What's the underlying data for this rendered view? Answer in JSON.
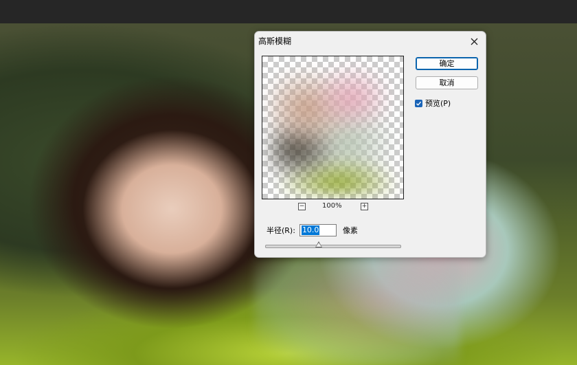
{
  "dialog": {
    "title": "高斯模糊",
    "ok_label": "确定",
    "cancel_label": "取消",
    "preview_label": "预览(P)",
    "preview_checked": true,
    "zoom_level": "100%",
    "zoom_out_symbol": "−",
    "zoom_in_symbol": "+",
    "radius_label": "半径(R):",
    "radius_value": "10.0",
    "radius_unit": "像素",
    "radius_slider_fraction": 0.4
  },
  "icons": {
    "close": "close-icon",
    "check": "checkmark-icon"
  },
  "colors": {
    "accent": "#1a64b7",
    "selection": "#0078d7",
    "dialog_bg": "#f0f0f0"
  }
}
